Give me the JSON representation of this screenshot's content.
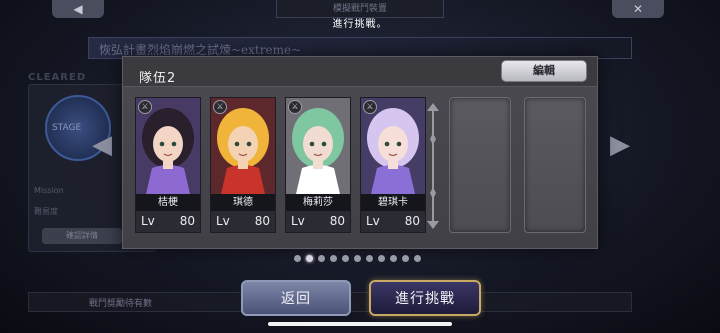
{
  "background": {
    "top_banner": "模擬戰鬥裝置",
    "top_subtitle": "進行挑戰。",
    "stage_title": "恢弘計畫烈焰崩燃之試煉~extreme~",
    "cleared_label": "CLEARED",
    "stage_label": "STAGE",
    "mission_label": "Mission",
    "difficulty_label": "難易度",
    "confirm_label": "確認詳情",
    "bottom_text": "戰鬥獎勵待有數"
  },
  "modal": {
    "title": "隊伍2",
    "edit_label": "編輯",
    "lv_label": "Lv",
    "members": [
      {
        "name": "桔梗",
        "level": "80",
        "class_icon": "sword-icon",
        "hair": "#2a1f2c",
        "skin": "#f3d5c6",
        "accent": "#8d6ad2"
      },
      {
        "name": "琪德",
        "level": "80",
        "class_icon": "sword-icon",
        "hair": "#f1b43a",
        "skin": "#f4d3b4",
        "accent": "#c8332c"
      },
      {
        "name": "梅莉莎",
        "level": "80",
        "class_icon": "sword-icon",
        "hair": "#7fc7a0",
        "skin": "#f0dcd0",
        "accent": "#ffffff"
      },
      {
        "name": "碧琪卡",
        "level": "80",
        "class_icon": "sword-icon",
        "hair": "#d6c5ef",
        "skin": "#f6dfd8",
        "accent": "#8a6fd6"
      }
    ],
    "empty_slots": 2
  },
  "pagination": {
    "count": 11,
    "active_index": 1
  },
  "buttons": {
    "back_label": "返回",
    "start_label": "進行挑戰"
  },
  "colors": {
    "start_border": "#c9a864",
    "back_fill": "#6a7396"
  }
}
